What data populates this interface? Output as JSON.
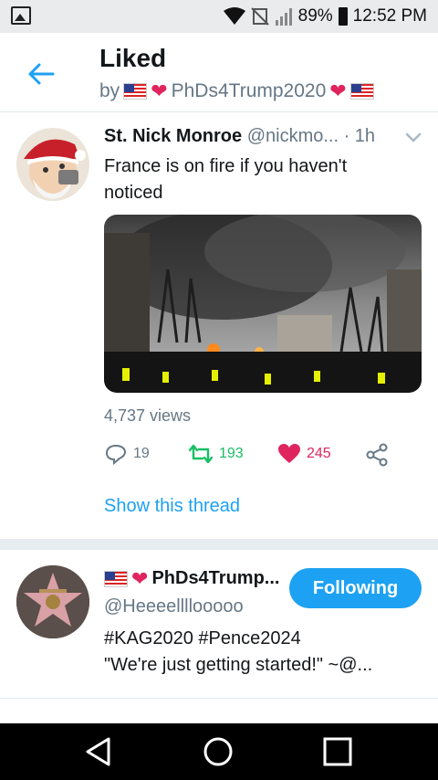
{
  "status_bar": {
    "battery": "89%",
    "time": "12:52 PM"
  },
  "header": {
    "title": "Liked",
    "by": "by",
    "user": "PhDs4Trump2020"
  },
  "tweet1": {
    "name": "St. Nick Monroe",
    "handle": "@nickmo...",
    "time": "· 1h",
    "text_line1": "France is on fire if you haven't",
    "text_line2": "noticed",
    "views": "4,737 views",
    "replies": "19",
    "retweets": "193",
    "likes": "245",
    "show_thread": "Show this thread"
  },
  "tweet2": {
    "name": "PhDs4Trump...",
    "handle": "@Heeeellllooooo",
    "follow_label": "Following",
    "text_line1": "#KAG2020 #Pence2024",
    "text_line2": "\"We're just getting started!\" ~@..."
  },
  "colors": {
    "accent": "#1da1f2",
    "like": "#e0245e",
    "retweet": "#17bf63",
    "secondary_text": "#657786"
  }
}
